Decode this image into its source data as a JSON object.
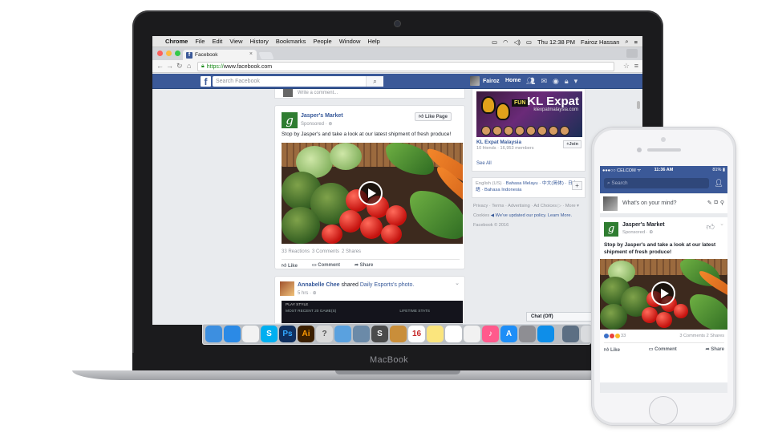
{
  "mac_menubar": {
    "items": [
      "Chrome",
      "File",
      "Edit",
      "View",
      "History",
      "Bookmarks",
      "People",
      "Window",
      "Help"
    ],
    "clock": "Thu 12:38 PM",
    "user": "Fairoz Hassan"
  },
  "browser": {
    "tab_title": "Facebook",
    "url_scheme": "https://",
    "url_host": "www.facebook.com"
  },
  "facebook": {
    "search_placeholder": "Search Facebook",
    "user_name": "Fairoz",
    "home_label": "Home",
    "comment_placeholder": "Write a comment...",
    "post": {
      "page_name": "Jasper's Market",
      "like_page_label": "Like Page",
      "sponsored": "Sponsored · ⊕",
      "text": "Stop by Jasper's and take a look at our latest shipment of fresh produce!",
      "reactions": "33 Reactions",
      "comments": "3 Comments",
      "shares": "2 Shares",
      "like": "Like",
      "comment": "Comment",
      "share": "Share"
    },
    "post2": {
      "author": "Annabelle Chee",
      "verb": "shared",
      "target": "Daily Esports's",
      "object": "photo.",
      "time": "5 hrs · ⊕",
      "play_style": "PLAY STYLE",
      "most_recent": "MOST RECENT 20 GAME(S)",
      "lifetime": "LIFETIME STATS"
    },
    "group": {
      "fun": "FUN",
      "kl_title": "KL Expat",
      "kl_sub": "klexpatmalaysia.com",
      "name": "KL Expat Malaysia",
      "meta": "10 friends · 16,953 members",
      "join": "Join",
      "see_all": "See All"
    },
    "languages": {
      "current": "English (US) · ",
      "links": "Bahasa Melayu · 中文(简体) · 日本語 · Bahasa Indonesia"
    },
    "footer": {
      "links": "Privacy · Terms · Advertising · Ad Choices ▷ · More ▾",
      "cookies": "Cookies",
      "cookies_notice": "◀ We've updated our policy. Learn More.",
      "copyright": "Facebook © 2016"
    },
    "chat": "Chat (Off)"
  },
  "dock": {
    "icons": [
      "finder-icon",
      "safari-icon",
      "chrome-icon",
      "skype-icon",
      "photoshop-icon",
      "illustrator-icon",
      "help-icon",
      "preview-icon",
      "iphoto-icon",
      "sublime-icon",
      "garageband-icon",
      "calendar-icon",
      "notes-icon",
      "reminders-icon",
      "photos-icon",
      "itunes-icon",
      "appstore-icon",
      "system-preferences-icon",
      "teamviewer-icon",
      "downloads-icon",
      "trash-icon"
    ],
    "labels": [
      "",
      "",
      "",
      "S",
      "Ps",
      "Ai",
      "?",
      "",
      "",
      "S",
      "",
      "16",
      "",
      "",
      "",
      "♪",
      "A",
      "",
      "",
      "",
      ""
    ],
    "colors": [
      "#3d8fe0",
      "#2b8ae6",
      "#f2f2f2",
      "#00aff0",
      "#0f2f5e",
      "#3b1f00",
      "#d9d9d9",
      "#5aa1df",
      "#6b8aa8",
      "#4b4b4b",
      "#c98e3a",
      "#ffffff",
      "#fbe57d",
      "#ffffff",
      "#f1f1f1",
      "#ff5a8c",
      "#1e8ef7",
      "#8e8e93",
      "#0e8ee9",
      "#5c6f83",
      "#d9dbde"
    ]
  },
  "laptop_label": "MacBook",
  "phone": {
    "carrier": "●●●○○ CELCOM ᯤ",
    "clock": "11:36 AM",
    "battery": "81% ▮",
    "search_placeholder": "Search",
    "mind_prompt": "What's on your mind?",
    "page_name": "Jasper's Market",
    "sponsored": "Sponsored · ⊕",
    "text": "Stop by Jasper's and take a look at our latest shipment of fresh produce!",
    "reaction_count": "33",
    "comments": "3 Comments",
    "shares": "2 Shares",
    "like": "Like",
    "comment": "Comment",
    "share": "Share"
  }
}
